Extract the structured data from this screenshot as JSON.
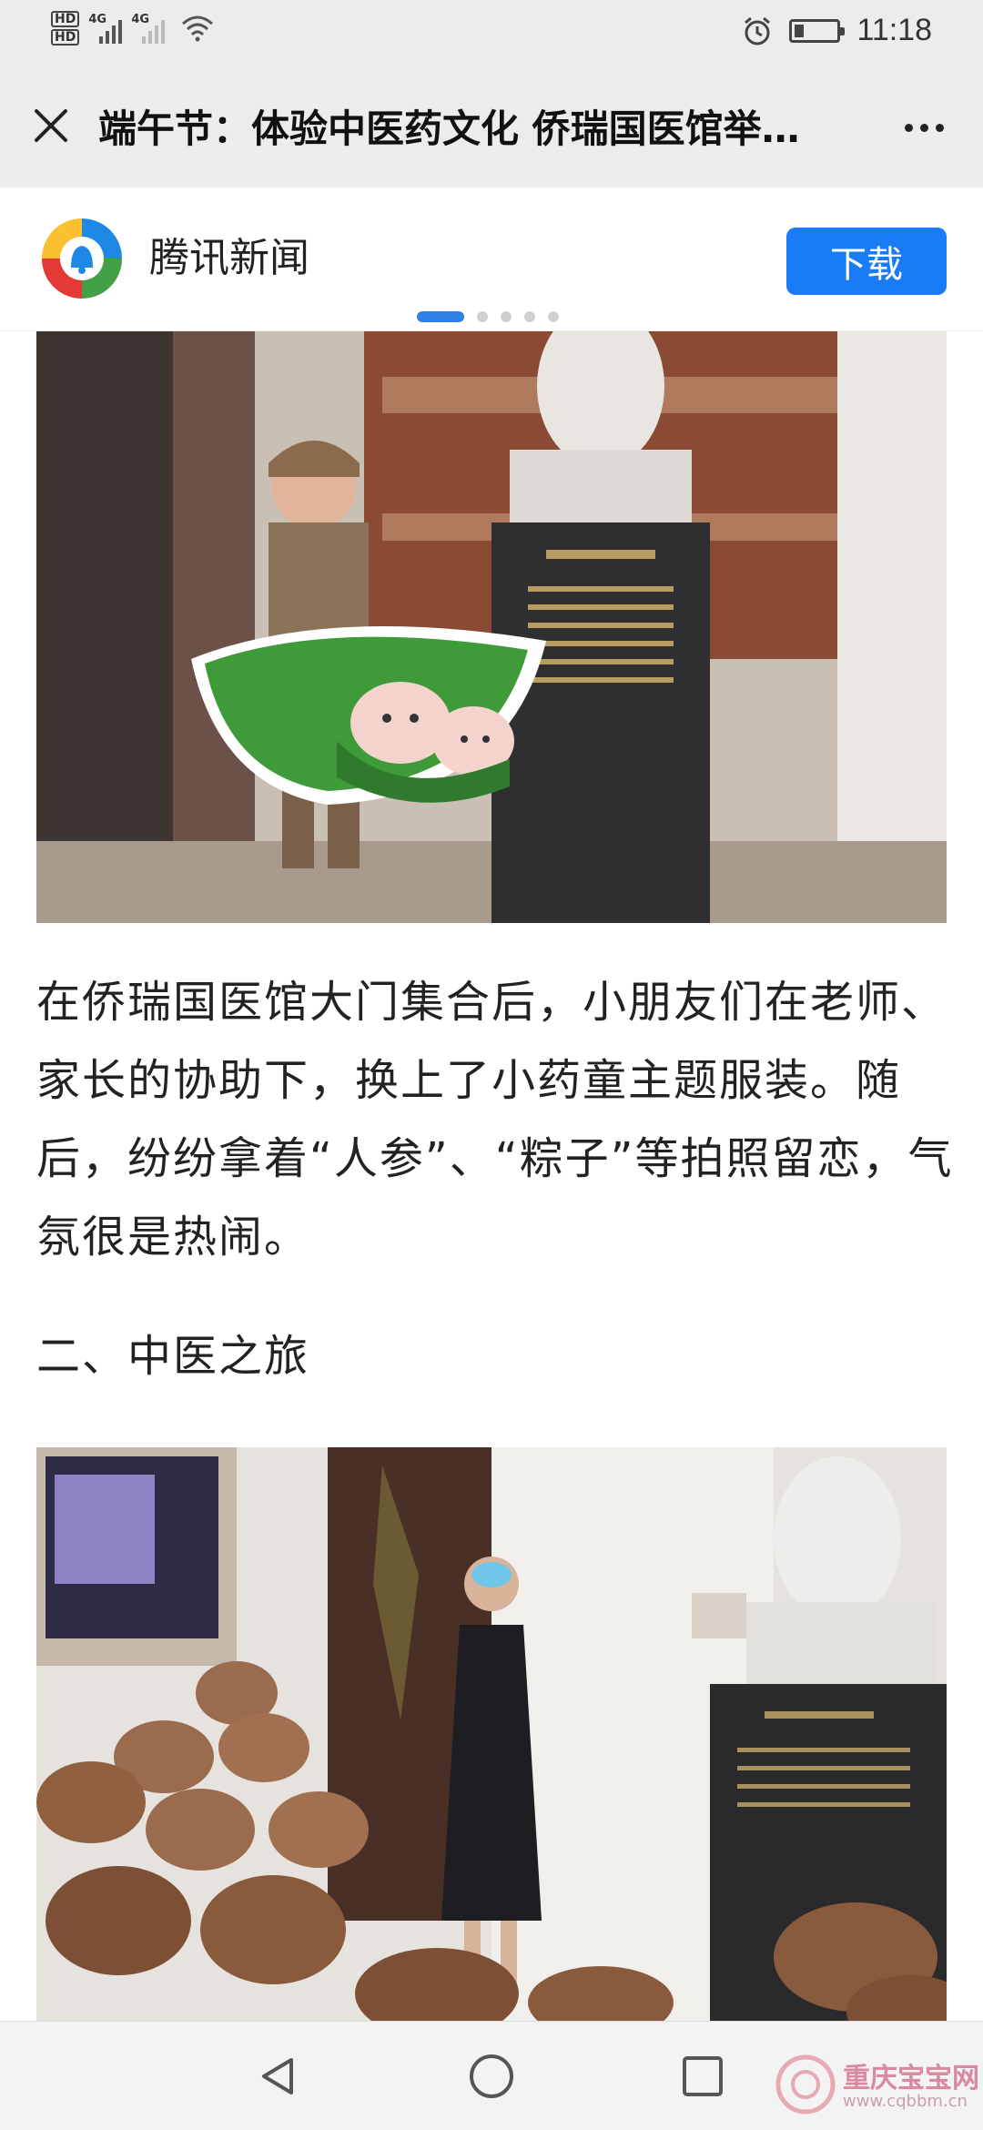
{
  "status_bar": {
    "hd_1": "HD",
    "hd_2": "HD",
    "network_1": "4G",
    "network_2": "4G",
    "time": "11:18"
  },
  "title_bar": {
    "title": "端午节：体验中医药文化 侨瑞国医馆举…"
  },
  "app_banner": {
    "app_name": "腾讯新闻",
    "download_label": "下载"
  },
  "article": {
    "paragraph": "在侨瑞国医馆大门集合后，小朋友们在老师、家长的协助下，换上了小药童主题服装。随后，纷纷拿着“人参”、“粽子”等拍照留恋，气氛很是热闹。",
    "section_heading": "二、中医之旅"
  },
  "watermark": {
    "name": "重庆宝宝网",
    "url": "www.cqbbm.cn"
  },
  "colors": {
    "accent": "#1a7cf4",
    "chrome": "#ececec",
    "text": "#222222"
  }
}
